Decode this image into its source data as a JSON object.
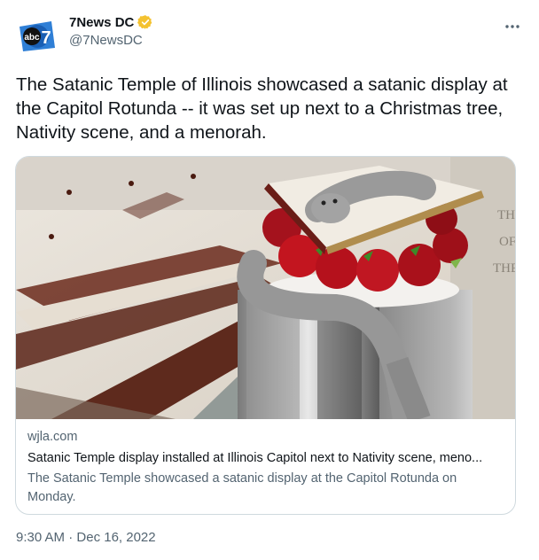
{
  "author": {
    "display_name": "7News DC",
    "handle": "@7NewsDC",
    "avatar_logo_text": "abc7",
    "verified_color": "#f4c230"
  },
  "tweet": {
    "text": "The Satanic Temple of Illinois showcased a satanic display at the Capitol Rotunda -- it was set up next to a Christmas tree, Nativity scene, and a menorah.",
    "time": "9:30 AM",
    "separator": " · ",
    "date": "Dec 16, 2022"
  },
  "card": {
    "domain": "wjla.com",
    "title": "Satanic Temple display installed at Illinois Capitol next to Nativity scene, meno...",
    "description": "The Satanic Temple showcased a satanic display at the Capitol Rotunda on Monday.",
    "image_wall_text": [
      "TH",
      "OF",
      "THE"
    ]
  },
  "icons": {
    "more": "more-horizontal-icon",
    "verified": "verified-badge-icon"
  },
  "colors": {
    "text_primary": "#0f1419",
    "text_secondary": "#536471",
    "border": "#cfd9de",
    "brand_blue": "#1d9bf0"
  }
}
